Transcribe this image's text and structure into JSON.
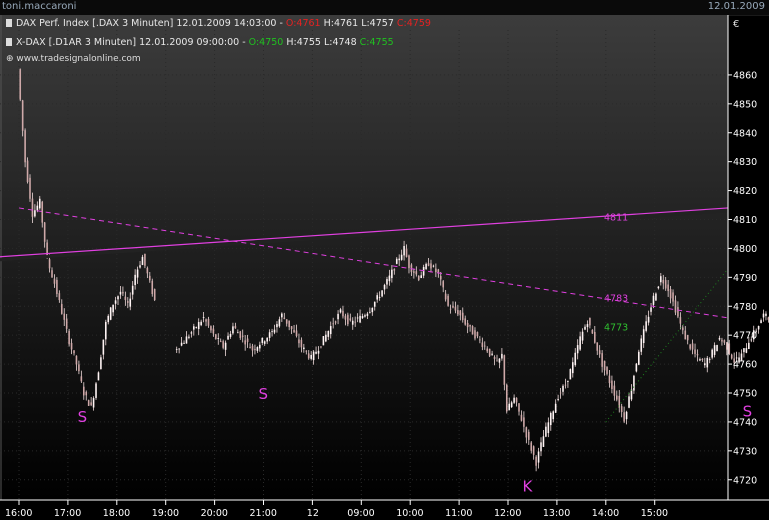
{
  "window": {
    "user": "toni.maccaroni",
    "date": "12.01.2009"
  },
  "legend": [
    {
      "label": "DAX Perf. Index [.DAX  3 Minuten] 12.01.2009 14:03:00 - ",
      "o": "O:4761",
      "h": "H:4761",
      "l": "L:4757",
      "c": "C:4759",
      "oc_color": "#e52222"
    },
    {
      "label": "X-DAX [.D1AR  3 Minuten] 12.01.2009 09:00:00 - ",
      "o": "O:4750",
      "h": "H:4755",
      "l": "L:4748",
      "c": "C:4755",
      "oc_color": "#20c020"
    }
  ],
  "watermark": "www.tradesignalonline.com",
  "currency": "€",
  "colors": {
    "background_top": "#3c3c3c",
    "background_bottom": "#000000",
    "candles": "#f0dcdc",
    "trendline": "#e040e0",
    "dotted": "#208020",
    "axis": "#ffffff"
  },
  "chart_data": {
    "type": "candlestick",
    "title": "DAX Perf. Index [.DAX 3 Minuten]",
    "ylim": [
      4713,
      4870
    ],
    "y_ticks": [
      4720,
      4730,
      4740,
      4750,
      4760,
      4770,
      4780,
      4790,
      4800,
      4810,
      4820,
      4830,
      4840,
      4850,
      4860
    ],
    "x_ticks": [
      "16:00",
      "17:00",
      "18:00",
      "19:00",
      "20:00",
      "21:00",
      "12",
      "09:00",
      "10:00",
      "11:00",
      "12:00",
      "13:00",
      "14:00",
      "15:00"
    ],
    "series": [
      {
        "name": "DAX Perf. Index",
        "points": [
          [
            0,
            4862
          ],
          [
            0.15,
            4830
          ],
          [
            0.3,
            4812
          ],
          [
            0.45,
            4816
          ],
          [
            0.6,
            4796
          ],
          [
            0.75,
            4788
          ],
          [
            0.9,
            4778
          ],
          [
            1.05,
            4768
          ],
          [
            1.2,
            4760
          ],
          [
            1.35,
            4750
          ],
          [
            1.5,
            4745
          ],
          [
            1.65,
            4758
          ],
          [
            1.8,
            4774
          ],
          [
            1.95,
            4781
          ],
          [
            2.1,
            4785
          ],
          [
            2.25,
            4780
          ],
          [
            2.4,
            4791
          ],
          [
            2.55,
            4797
          ],
          [
            2.7,
            4788
          ],
          [
            2.8,
            4782
          ],
          [
            3.2,
            4765
          ],
          [
            3.4,
            4768
          ],
          [
            3.6,
            4772
          ],
          [
            3.8,
            4776
          ],
          [
            4.0,
            4770
          ],
          [
            4.2,
            4766
          ],
          [
            4.4,
            4773
          ],
          [
            4.6,
            4769
          ],
          [
            4.8,
            4765
          ],
          [
            5.0,
            4768
          ],
          [
            5.2,
            4771
          ],
          [
            5.4,
            4777
          ],
          [
            5.6,
            4772
          ],
          [
            5.8,
            4766
          ],
          [
            6.0,
            4762
          ],
          [
            6.2,
            4767
          ],
          [
            6.4,
            4773
          ],
          [
            6.6,
            4778
          ],
          [
            6.8,
            4774
          ],
          [
            7.0,
            4776
          ],
          [
            7.2,
            4779
          ],
          [
            7.4,
            4784
          ],
          [
            7.6,
            4790
          ],
          [
            7.8,
            4797
          ],
          [
            7.9,
            4800
          ],
          [
            8.0,
            4794
          ],
          [
            8.2,
            4790
          ],
          [
            8.4,
            4795
          ],
          [
            8.6,
            4791
          ],
          [
            8.8,
            4780
          ],
          [
            9.0,
            4778
          ],
          [
            9.2,
            4773
          ],
          [
            9.4,
            4769
          ],
          [
            9.6,
            4765
          ],
          [
            9.8,
            4760
          ],
          [
            9.9,
            4763
          ],
          [
            10.0,
            4744
          ],
          [
            10.15,
            4748
          ],
          [
            10.3,
            4741
          ],
          [
            10.45,
            4733
          ],
          [
            10.6,
            4726
          ],
          [
            10.75,
            4735
          ],
          [
            10.9,
            4742
          ],
          [
            11.05,
            4749
          ],
          [
            11.2,
            4753
          ],
          [
            11.35,
            4760
          ],
          [
            11.5,
            4769
          ],
          [
            11.65,
            4775
          ],
          [
            11.8,
            4768
          ],
          [
            11.95,
            4760
          ],
          [
            12.1,
            4754
          ],
          [
            12.25,
            4748
          ],
          [
            12.4,
            4741
          ],
          [
            12.55,
            4752
          ],
          [
            12.7,
            4765
          ],
          [
            12.85,
            4774
          ],
          [
            13.0,
            4783
          ],
          [
            13.15,
            4790
          ],
          [
            13.3,
            4786
          ],
          [
            13.45,
            4779
          ],
          [
            13.6,
            4771
          ],
          [
            13.75,
            4766
          ],
          [
            13.9,
            4762
          ],
          [
            14.05,
            4760
          ],
          [
            14.2,
            4764
          ],
          [
            14.35,
            4769
          ],
          [
            14.5,
            4766
          ],
          [
            14.65,
            4761
          ],
          [
            14.8,
            4763
          ],
          [
            14.95,
            4768
          ],
          [
            15.1,
            4772
          ],
          [
            15.25,
            4777
          ],
          [
            15.4,
            4775
          ],
          [
            15.55,
            4770
          ],
          [
            15.7,
            4766
          ],
          [
            15.85,
            4764
          ],
          [
            16.0,
            4768
          ],
          [
            16.15,
            4771
          ],
          [
            16.3,
            4769
          ],
          [
            16.45,
            4772
          ],
          [
            16.6,
            4770
          ],
          [
            16.75,
            4773
          ],
          [
            16.9,
            4771
          ],
          [
            17.05,
            4775
          ],
          [
            17.2,
            4769
          ],
          [
            17.3,
            4762
          ]
        ]
      }
    ],
    "annotations": {
      "solid_trendline": {
        "from": [
          -0.5,
          4797
        ],
        "to": [
          22.0,
          4814
        ],
        "label": "4811"
      },
      "dashed_trendline": {
        "from": [
          0.0,
          4814
        ],
        "to": [
          22.0,
          4776
        ],
        "label": "4783"
      },
      "dotted_trendline": {
        "from": [
          12.0,
          4740
        ],
        "to": [
          22.0,
          4793
        ],
        "label": "4773"
      },
      "letters": [
        {
          "text": "S",
          "x": 1.3,
          "y": 4742
        },
        {
          "text": "S",
          "x": 5.0,
          "y": 4750
        },
        {
          "text": "K",
          "x": 10.4,
          "y": 4718
        },
        {
          "text": "S",
          "x": 14.9,
          "y": 4744
        }
      ]
    }
  }
}
